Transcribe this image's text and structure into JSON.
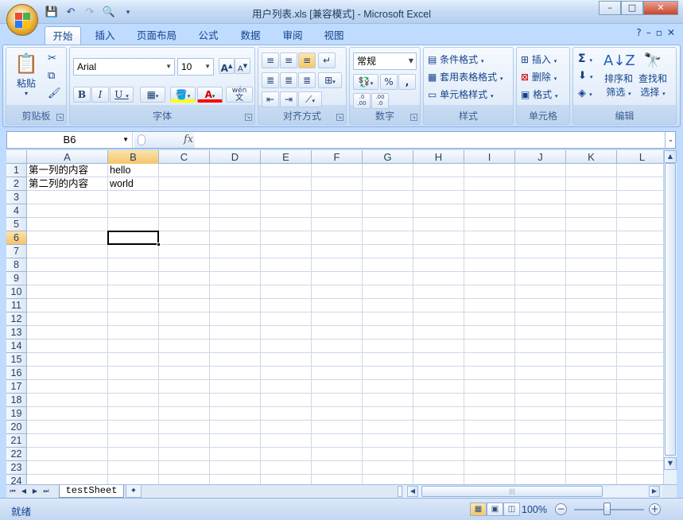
{
  "window": {
    "title": "用户列表.xls  [兼容模式] - Microsoft Excel",
    "controls": [
      "–",
      "□",
      "✕"
    ]
  },
  "ribbon_tabs": [
    "开始",
    "插入",
    "页面布局",
    "公式",
    "数据",
    "审阅",
    "视图"
  ],
  "active_tab": "开始",
  "help_controls": [
    "?",
    "–",
    "▫",
    "✕"
  ],
  "groups": {
    "clipboard": {
      "label": "剪贴板",
      "paste": "粘贴"
    },
    "font": {
      "label": "字体",
      "font_name": "Arial",
      "font_size": "10",
      "bold": "B",
      "italic": "I",
      "underline": "U",
      "phonetic": "wén",
      "phonetic_char": "文"
    },
    "alignment": {
      "label": "对齐方式"
    },
    "number": {
      "label": "数字",
      "format": "常规",
      "percent": "%",
      "comma": ",",
      "inc_decimal": ".0\n.00",
      "dec_decimal": ".00\n.0"
    },
    "styles": {
      "label": "样式",
      "conditional": "条件格式",
      "table": "套用表格格式",
      "cell": "单元格样式"
    },
    "cells": {
      "label": "单元格",
      "insert": "插入",
      "delete": "删除",
      "format": "格式"
    },
    "editing": {
      "label": "编辑",
      "sort_filter": "排序和",
      "sort_filter2": "筛选",
      "find_select": "查找和",
      "find_select2": "选择"
    }
  },
  "formula_bar": {
    "name_box": "B6",
    "fx": "fx",
    "value": ""
  },
  "columns": [
    "A",
    "B",
    "C",
    "D",
    "E",
    "F",
    "G",
    "H",
    "I",
    "J",
    "K",
    "L"
  ],
  "rows": [
    "1",
    "2",
    "3",
    "4",
    "5",
    "6",
    "7",
    "8",
    "9",
    "10",
    "11",
    "12",
    "13",
    "14",
    "15",
    "16",
    "17",
    "18",
    "19",
    "20",
    "21",
    "22",
    "23",
    "24"
  ],
  "cells": {
    "A1": "第一列的内容",
    "B1": "hello",
    "A2": "第二列的内容",
    "B2": "world"
  },
  "selected_cell": "B6",
  "sheet_tabs": [
    "testSheet"
  ],
  "status": {
    "text": "就绪",
    "zoom": "100%"
  }
}
